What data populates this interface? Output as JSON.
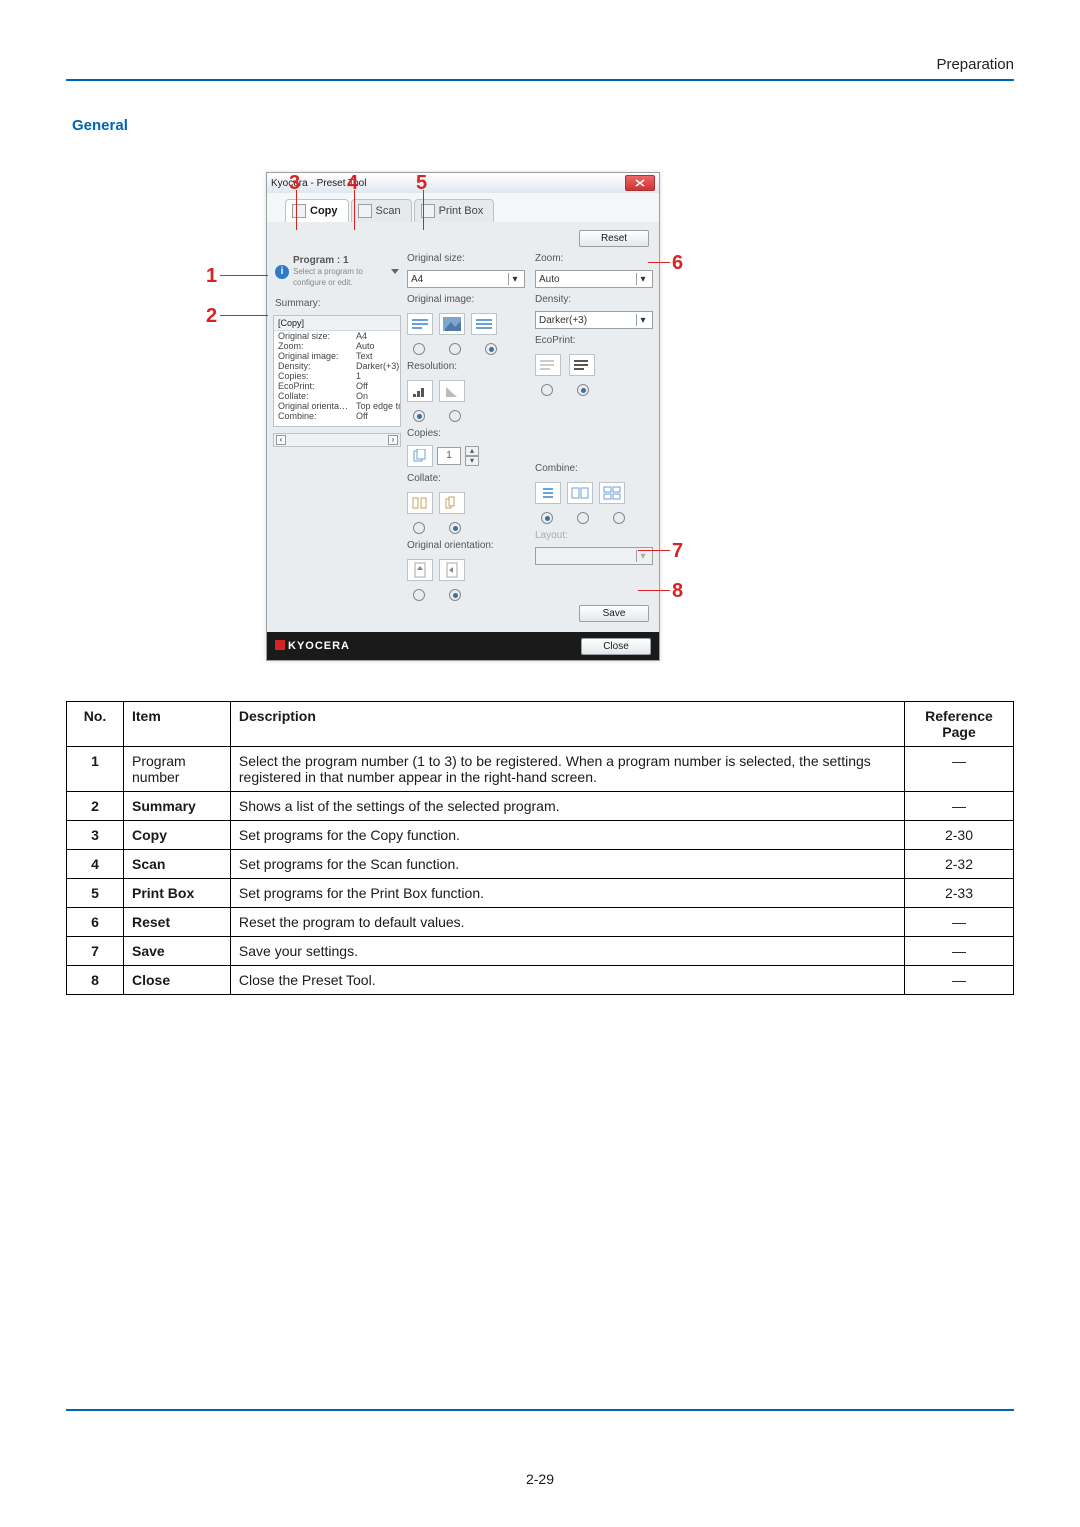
{
  "header": {
    "title": "Preparation",
    "page_number": "2-29"
  },
  "section_title": "General",
  "callouts": {
    "n1": "1",
    "n2": "2",
    "n3": "3",
    "n4": "4",
    "n5": "5",
    "n6": "6",
    "n7": "7",
    "n8": "8"
  },
  "win": {
    "title": "Kyocera              - Preset Tool",
    "tabs": {
      "copy": "Copy",
      "scan": "Scan",
      "printbox": "Print Box"
    },
    "reset_btn": "Reset",
    "save_btn": "Save",
    "close_btn": "Close",
    "brand": "KYOCERA",
    "program": {
      "header": "Program : 1",
      "hint": "Select a program to configure or edit."
    },
    "summary": {
      "label": "Summary:",
      "group": "[Copy]",
      "rows": [
        {
          "k": "Original size:",
          "v": "A4"
        },
        {
          "k": "Zoom:",
          "v": "Auto"
        },
        {
          "k": "Original image:",
          "v": "Text"
        },
        {
          "k": "Density:",
          "v": "Darker(+3)"
        },
        {
          "k": "Copies:",
          "v": "1"
        },
        {
          "k": "EcoPrint:",
          "v": "Off"
        },
        {
          "k": "Collate:",
          "v": "On"
        },
        {
          "k": "Original orienta…",
          "v": "Top edge top"
        },
        {
          "k": "Combine:",
          "v": "Off"
        }
      ]
    },
    "settings": {
      "original_size": {
        "label": "Original size:",
        "value": "A4"
      },
      "zoom": {
        "label": "Zoom:",
        "value": "Auto"
      },
      "original_image": {
        "label": "Original image:"
      },
      "density": {
        "label": "Density:",
        "value": "Darker(+3)"
      },
      "ecoprint": {
        "label": "EcoPrint:"
      },
      "resolution": {
        "label": "Resolution:"
      },
      "copies": {
        "label": "Copies:",
        "value": "1"
      },
      "collate": {
        "label": "Collate:"
      },
      "combine": {
        "label": "Combine:"
      },
      "layout": {
        "label": "Layout:"
      },
      "orientation": {
        "label": "Original orientation:"
      }
    }
  },
  "table": {
    "headers": {
      "no": "No.",
      "item": "Item",
      "desc": "Description",
      "ref": "Reference Page"
    },
    "rows": [
      {
        "no": "1",
        "item": "Program number",
        "item_bold": false,
        "desc": "Select the program number (1 to 3) to be registered. When a program number is selected, the settings registered in that number appear in the right-hand screen.",
        "ref": "—"
      },
      {
        "no": "2",
        "item": "Summary",
        "item_bold": true,
        "desc": "Shows a list of the settings of the selected program.",
        "ref": "—"
      },
      {
        "no": "3",
        "item": "Copy",
        "item_bold": true,
        "desc": "Set programs for the Copy function.",
        "ref": "2-30"
      },
      {
        "no": "4",
        "item": "Scan",
        "item_bold": true,
        "desc": "Set programs for the Scan function.",
        "ref": "2-32"
      },
      {
        "no": "5",
        "item": "Print Box",
        "item_bold": true,
        "desc": "Set programs for the Print Box function.",
        "ref": "2-33"
      },
      {
        "no": "6",
        "item": "Reset",
        "item_bold": true,
        "desc": "Reset the program to default values.",
        "ref": "—"
      },
      {
        "no": "7",
        "item": "Save",
        "item_bold": true,
        "desc": "Save your settings.",
        "ref": "—"
      },
      {
        "no": "8",
        "item": "Close",
        "item_bold": true,
        "desc": "Close the Preset Tool.",
        "ref": "—"
      }
    ]
  }
}
